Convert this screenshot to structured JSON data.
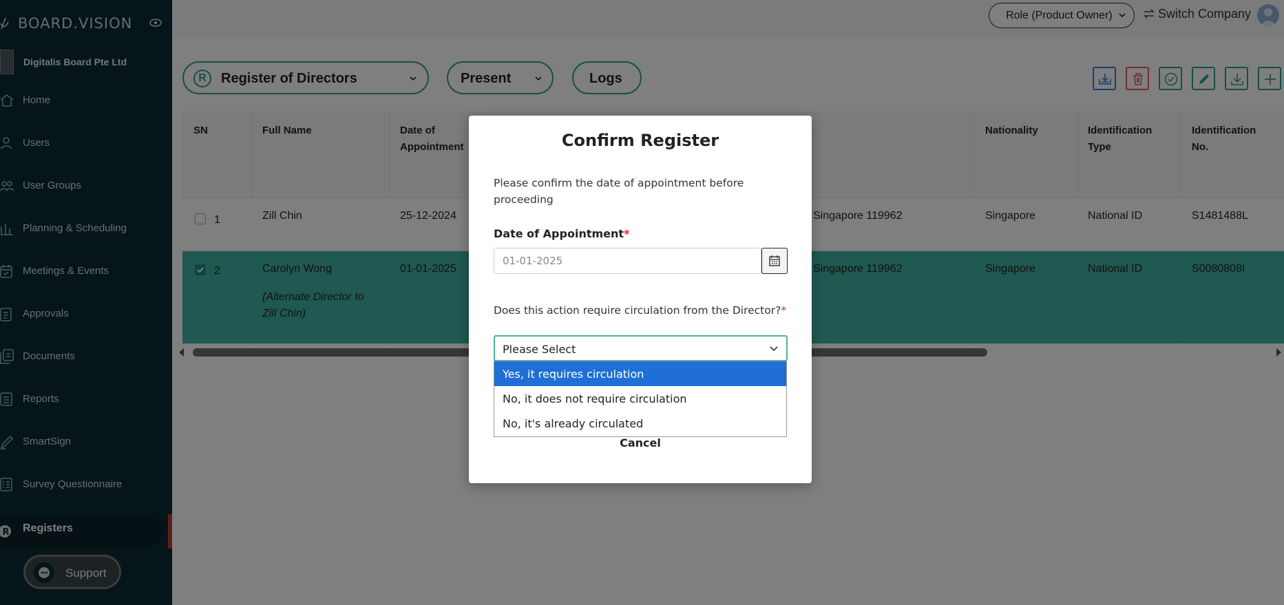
{
  "brand": {
    "name": "BOARD.VISION"
  },
  "company": {
    "name": "Digitalis Board Pte Ltd"
  },
  "sidebar": {
    "items": [
      {
        "label": "Home",
        "icon": "home-icon"
      },
      {
        "label": "Users",
        "icon": "user-icon"
      },
      {
        "label": "User Groups",
        "icon": "users-icon"
      },
      {
        "label": "Planning & Scheduling",
        "icon": "chart-bars-icon"
      },
      {
        "label": "Meetings & Events",
        "icon": "calendar-icon"
      },
      {
        "label": "Approvals",
        "icon": "checklist-icon"
      },
      {
        "label": "Documents",
        "icon": "documents-icon"
      },
      {
        "label": "Reports",
        "icon": "report-icon"
      },
      {
        "label": "SmartSign",
        "icon": "pen-icon"
      },
      {
        "label": "Survey Questionnaire",
        "icon": "survey-icon"
      },
      {
        "label": "Registers",
        "icon": "registers-icon",
        "active": true
      }
    ],
    "support_label": "Support"
  },
  "header": {
    "role": "Role (Product Owner)",
    "switch_company": "Switch Company"
  },
  "toolbar": {
    "register_select": "Register of Directors",
    "register_badge": "R",
    "status_select": "Present",
    "logs": "Logs"
  },
  "table": {
    "columns": [
      "SN",
      "Full Name",
      "Date of Appointment",
      "Nationality",
      "Identification Type",
      "Identification No."
    ],
    "rows": [
      {
        "sn": "1",
        "checked": false,
        "full_name": "Zill Chin",
        "alt_note": "",
        "date": "25-12-2024",
        "address": "Singapore 119962",
        "nationality": "Singapore",
        "id_type": "National ID",
        "id_no": "S1481488L"
      },
      {
        "sn": "2",
        "checked": true,
        "full_name": "Carolyn Wong",
        "alt_note": "(Alternate Director to Zill Chin)",
        "date": "01-01-2025",
        "address": "Singapore 119962",
        "nationality": "Singapore",
        "id_type": "National ID",
        "id_no": "S0080808I"
      }
    ]
  },
  "modal": {
    "title": "Confirm Register",
    "description": "Please confirm the date of appointment before proceeding",
    "date_label": "Date of Appointment",
    "date_value": "01-01-2025",
    "question": "Does this action require circulation from the Director?",
    "required_mark": "*",
    "select_value": "Please Select",
    "options": [
      "Yes, it requires circulation",
      "No, it does not require circulation",
      "No, it's already circulated"
    ],
    "selected_option_index": 0,
    "cancel": "Cancel"
  },
  "colors": {
    "sidebar_bg": "#0b2b33",
    "accent": "#2f9e8d",
    "selected_row": "#3fb3a2",
    "danger": "#e35d5d",
    "option_highlight": "#1f6fd6"
  }
}
